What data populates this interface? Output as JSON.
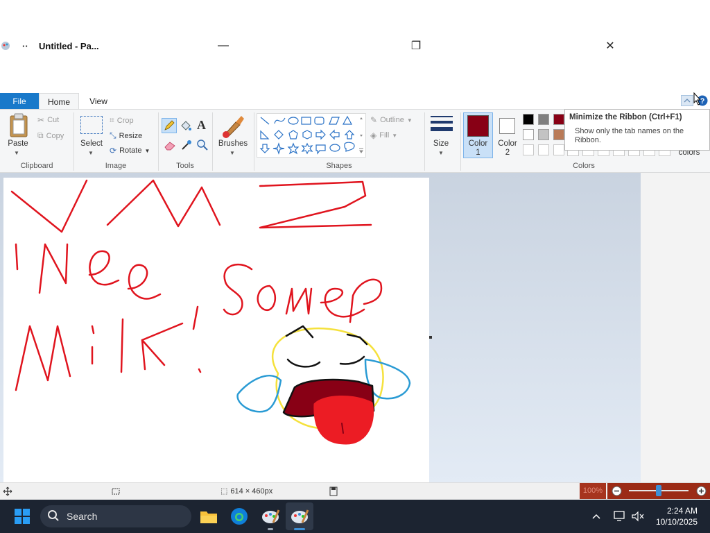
{
  "window": {
    "title": "Untitled - Pa...",
    "sep_glyph": "··",
    "minimize_glyph": "—",
    "restore_glyph": "❐",
    "close_glyph": "✕"
  },
  "tabs": {
    "file": "File",
    "home": "Home",
    "view": "View"
  },
  "clipboard": {
    "paste": "Paste",
    "cut": "Cut",
    "copy": "Copy",
    "group": "Clipboard"
  },
  "image": {
    "select": "Select",
    "crop": "Crop",
    "resize": "Resize",
    "rotate": "Rotate",
    "group": "Image"
  },
  "tools": {
    "group": "Tools"
  },
  "brushes": {
    "label": "Brushes"
  },
  "shapes": {
    "outline": "Outline",
    "fill": "Fill",
    "group": "Shapes"
  },
  "size": {
    "label": "Size"
  },
  "colors": {
    "color1_line1": "Color",
    "color1_line2": "1",
    "color2_line1": "Color",
    "color2_line2": "2",
    "edit_partial": "colors",
    "group": "Colors",
    "color1_value": "#880015",
    "color2_value": "#ffffff",
    "palette_row1": [
      "#000000",
      "#7f7f7f",
      "#880015"
    ],
    "palette_row2": [
      "#ffffff",
      "#c3c3c3",
      "#b97a57"
    ]
  },
  "tooltip": {
    "title": "Minimize the Ribbon (Ctrl+F1)",
    "desc_line1": "Show only the tab names on the",
    "desc_line2": "Ribbon."
  },
  "status": {
    "canvas_size": "614 × 460px",
    "zoom": "100%"
  },
  "taskbar": {
    "search": "Search",
    "time": "2:24 AM",
    "date": "10/10/2025"
  },
  "accent": "#1979ca",
  "ink_color": "#e0141e"
}
